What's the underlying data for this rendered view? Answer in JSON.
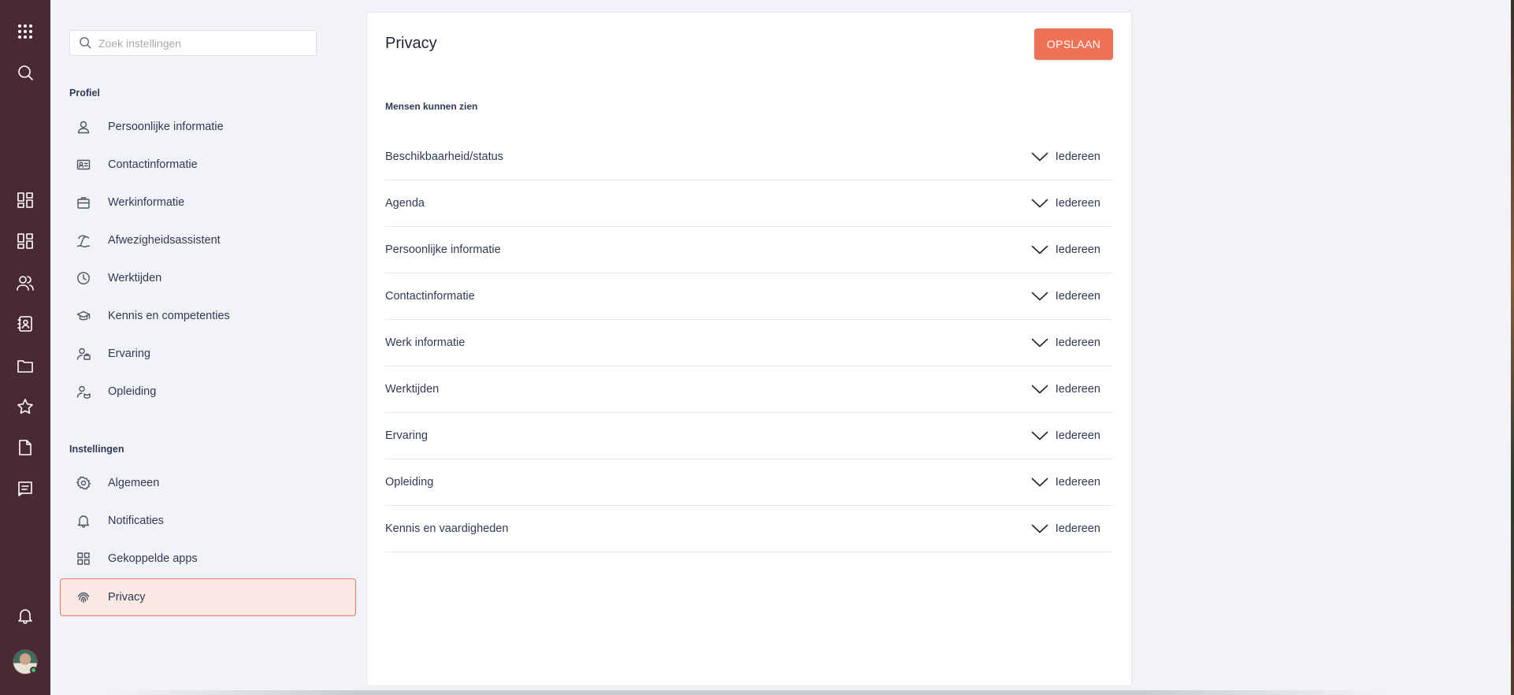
{
  "rail": {
    "items": [
      {
        "name": "apps-grid-icon"
      },
      {
        "name": "search-icon"
      },
      {
        "name": "dashboard-icon"
      },
      {
        "name": "dashboard-alt-icon"
      },
      {
        "name": "people-icon"
      },
      {
        "name": "contacts-book-icon"
      },
      {
        "name": "folder-icon"
      },
      {
        "name": "star-icon"
      },
      {
        "name": "document-icon"
      },
      {
        "name": "message-icon"
      },
      {
        "name": "bell-icon"
      }
    ],
    "status_color": "#3cc46f"
  },
  "sidebar": {
    "search": {
      "placeholder": "Zoek instellingen",
      "value": ""
    },
    "profile_section": {
      "title": "Profiel",
      "items": [
        {
          "label": "Persoonlijke informatie",
          "icon": "person-icon"
        },
        {
          "label": "Contactinformatie",
          "icon": "id-card-icon"
        },
        {
          "label": "Werkinformatie",
          "icon": "briefcase-icon"
        },
        {
          "label": "Afwezigheidsassistent",
          "icon": "beach-icon"
        },
        {
          "label": "Werktijden",
          "icon": "clock-icon"
        },
        {
          "label": "Kennis en competenties",
          "icon": "graduation-cap-icon"
        },
        {
          "label": "Ervaring",
          "icon": "person-briefcase-icon"
        },
        {
          "label": "Opleiding",
          "icon": "person-book-icon"
        }
      ]
    },
    "settings_section": {
      "title": "Instellingen",
      "items": [
        {
          "label": "Algemeen",
          "icon": "gear-icon"
        },
        {
          "label": "Notificaties",
          "icon": "bell-icon"
        },
        {
          "label": "Gekoppelde apps",
          "icon": "apps-icon"
        },
        {
          "label": "Privacy",
          "icon": "fingerprint-icon",
          "active": true
        }
      ]
    }
  },
  "main": {
    "title": "Privacy",
    "save_label": "OPSLAAN",
    "subheading": "Mensen kunnen zien",
    "rows": [
      {
        "label": "Beschikbaarheid/status",
        "value": "Iedereen"
      },
      {
        "label": "Agenda",
        "value": "Iedereen"
      },
      {
        "label": "Persoonlijke informatie",
        "value": "Iedereen"
      },
      {
        "label": "Contactinformatie",
        "value": "Iedereen"
      },
      {
        "label": "Werk informatie",
        "value": "Iedereen"
      },
      {
        "label": "Werktijden",
        "value": "Iedereen"
      },
      {
        "label": "Ervaring",
        "value": "Iedereen"
      },
      {
        "label": "Opleiding",
        "value": "Iedereen"
      },
      {
        "label": "Kennis en vaardigheden",
        "value": "Iedereen"
      }
    ]
  },
  "colors": {
    "rail": "#4a2a32",
    "accent": "#f07156",
    "active_bg": "#fbe9e6",
    "active_border": "#e8775f"
  }
}
